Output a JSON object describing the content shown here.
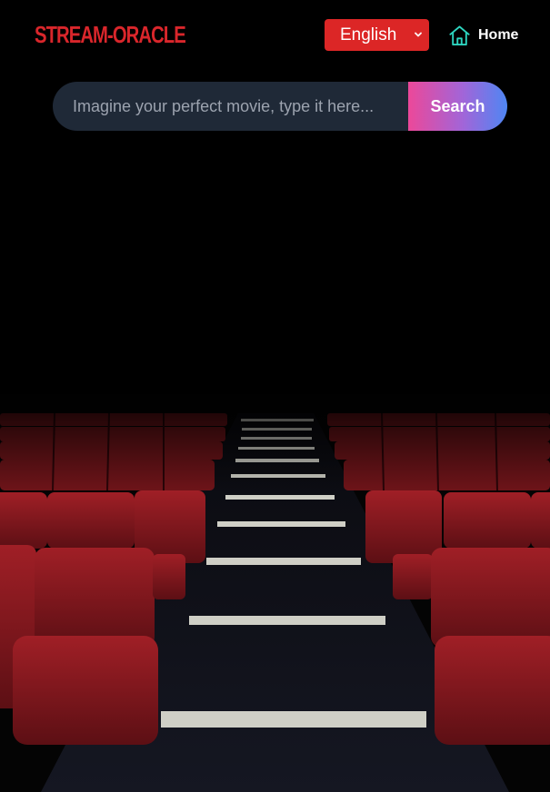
{
  "header": {
    "logo_text": "STREAM-ORACLE",
    "language": {
      "selected": "English",
      "icon": "chevron-down-icon"
    },
    "home": {
      "label": "Home",
      "icon": "home-icon"
    }
  },
  "search": {
    "placeholder": "Imagine your perfect movie, type it here...",
    "value": "",
    "button_label": "Search"
  },
  "background": {
    "description_icon": "cinema-seats-image"
  },
  "colors": {
    "brand": "#d9262b",
    "language_button": "#dc2626",
    "home_icon": "#2dd4bf",
    "input_bg": "#1f2937",
    "search_gradient_start": "#ec4899",
    "search_gradient_end": "#4f86f3",
    "seat": "#8b1a20",
    "page_bg": "#000000"
  }
}
